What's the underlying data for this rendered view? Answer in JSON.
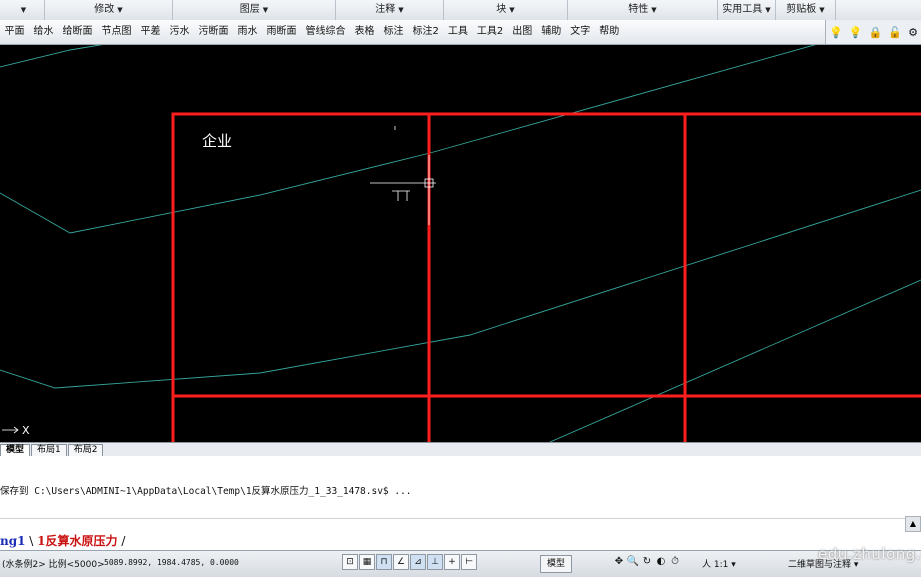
{
  "ribbon_panels": [
    {
      "label": "",
      "width": 45
    },
    {
      "label": "修改",
      "width": 128
    },
    {
      "label": "图层",
      "width": 163
    },
    {
      "label": "注释",
      "width": 108
    },
    {
      "label": "块",
      "width": 124
    },
    {
      "label": "特性",
      "width": 150
    },
    {
      "label": "实用工具",
      "width": 58
    },
    {
      "label": "剪贴板",
      "width": 60
    }
  ],
  "menu_items": [
    "平面",
    "给水",
    "给断面",
    "节点图",
    "平差",
    "污水",
    "污断面",
    "雨水",
    "雨断面",
    "管线综合",
    "表格",
    "标注",
    "标注2",
    "工具",
    "工具2",
    "出图",
    "辅助",
    "文字",
    "帮助"
  ],
  "status_icons": [
    "light-bulb-icon",
    "idea-bulb-icon",
    "lock-icon",
    "unlock-icon",
    "gear-icon"
  ],
  "canvas": {
    "label_company": "企业",
    "ucs_axis": "X",
    "lines_color": "#35a69b",
    "grid_color": "#ff1e1e"
  },
  "layout_tabs": [
    "模型",
    "布局1",
    "布局2"
  ],
  "command_line": {
    "history": "保存到 C:\\Users\\ADMINI~1\\AppData\\Local\\Temp\\1反算水原压力_1_33_1478.sv$ ...",
    "file_tab_1": "ng1",
    "file_tab_2": "1反算水原压力"
  },
  "status_bar": {
    "scale_label": "(水条例2> 比例<5000>",
    "coords": "5089.8992, 1984.4785, 0.0000",
    "toggles": [
      "⊡",
      "▦",
      "⊓",
      "∠",
      "⊿",
      "⊥",
      "+",
      "⊢"
    ],
    "model_label": "模型",
    "view_icons": [
      "✥",
      "🔍",
      "↻",
      "◐",
      "⏱"
    ],
    "anno_scale": "人 1:1 ▾",
    "workspace": "二维草图与注释 ▾",
    "watermark": "edu.zhulong.com"
  }
}
